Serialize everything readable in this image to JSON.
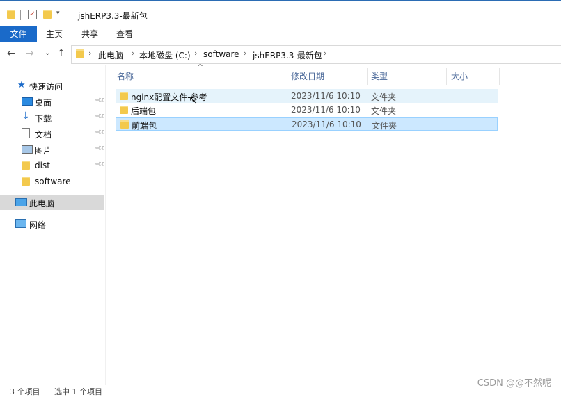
{
  "window": {
    "title": "jshERP3.3-最新包"
  },
  "ribbon": {
    "tabs": [
      "文件",
      "主页",
      "共享",
      "查看"
    ]
  },
  "address": {
    "segments": [
      "此电脑",
      "本地磁盘 (C:)",
      "software",
      "jshERP3.3-最新包"
    ]
  },
  "navpane": {
    "quick_access": "快速访问",
    "items": [
      {
        "label": "桌面",
        "icon": "desktop-icon",
        "pinned": true
      },
      {
        "label": "下载",
        "icon": "download-icon",
        "pinned": true
      },
      {
        "label": "文档",
        "icon": "document-icon",
        "pinned": true
      },
      {
        "label": "图片",
        "icon": "picture-icon",
        "pinned": true
      },
      {
        "label": "dist",
        "icon": "folder-icon",
        "pinned": true
      },
      {
        "label": "software",
        "icon": "folder-icon",
        "pinned": false
      }
    ],
    "this_pc": "此电脑",
    "network": "网络"
  },
  "columns": {
    "name": "名称",
    "date": "修改日期",
    "type": "类型",
    "size": "大小"
  },
  "files": [
    {
      "name": "nginx配置文件-参考",
      "date": "2023/11/6 10:10",
      "type": "文件夹",
      "state": "hover"
    },
    {
      "name": "后端包",
      "date": "2023/11/6 10:10",
      "type": "文件夹",
      "state": "normal"
    },
    {
      "name": "前端包",
      "date": "2023/11/6 10:10",
      "type": "文件夹",
      "state": "selected"
    }
  ],
  "status": {
    "count": "3 个项目",
    "selected": "选中 1 个项目"
  },
  "watermark": "CSDN @@不然呢"
}
